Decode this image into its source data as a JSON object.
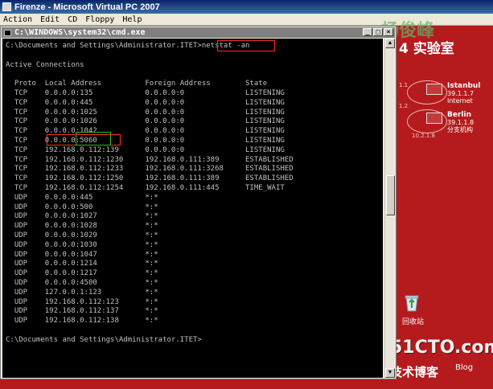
{
  "vpc": {
    "title": "Firenze - Microsoft Virtual PC 2007",
    "menu": [
      "Action",
      "Edit",
      "CD",
      "Floppy",
      "Help"
    ]
  },
  "cmd": {
    "title": "C:\\WINDOWS\\system32\\cmd.exe",
    "buttons": [
      "_",
      "□",
      "×"
    ],
    "lines": [
      "C:\\Documents and Settings\\Administrator.ITET>netstat -an",
      "",
      "Active Connections",
      "",
      "  Proto  Local Address          Foreign Address        State",
      "  TCP    0.0.0.0:135            0.0.0.0:0              LISTENING",
      "  TCP    0.0.0.0:445            0.0.0.0:0              LISTENING",
      "  TCP    0.0.0.0:1025           0.0.0.0:0              LISTENING",
      "  TCP    0.0.0.0:1026           0.0.0.0:0              LISTENING",
      "  TCP    0.0.0.0:1042           0.0.0.0:0              LISTENING",
      "  TCP    0.0.0.0:5060           0.0.0.0:0              LISTENING",
      "  TCP    192.168.0.112:139      0.0.0.0:0              LISTENING",
      "  TCP    192.168.0.112:1230     192.168.0.111:389      ESTABLISHED",
      "  TCP    192.168.0.112:1233     192.168.0.111:3268     ESTABLISHED",
      "  TCP    192.168.0.112:1250     192.168.0.111:389      ESTABLISHED",
      "  TCP    192.168.0.112:1254     192.168.0.111:445      TIME_WAIT",
      "  UDP    0.0.0.0:445            *:*",
      "  UDP    0.0.0.0:500            *:*",
      "  UDP    0.0.0.0:1027           *:*",
      "  UDP    0.0.0.0:1028           *:*",
      "  UDP    0.0.0.0:1029           *:*",
      "  UDP    0.0.0.0:1030           *:*",
      "  UDP    0.0.0.0:1047           *:*",
      "  UDP    0.0.0.0:1214           *:*",
      "  UDP    0.0.0.0:1217           *:*",
      "  UDP    0.0.0.0:4500           *:*",
      "  UDP    127.0.0.1:123          *:*",
      "  UDP    192.168.0.112:123      *:*",
      "  UDP    192.168.0.112:137      *:*",
      "  UDP    192.168.0.112:138      *:*",
      "",
      "C:\\Documents and Settings\\Administrator.ITET>"
    ]
  },
  "desktop": {
    "lab_title": "4 实验室",
    "watermark_top": "杨俊峰",
    "node1": {
      "name": "Istanbul",
      "ip": "39.1.1.7",
      "sub": "Internet"
    },
    "node2": {
      "name": "Berlin",
      "ip": "39.1.1.8",
      "sub": "分支机构"
    },
    "ip_a": "1.1",
    "ip_b": "1.2",
    "ip_c": "10.2.1.8",
    "recycle_label": "回收站",
    "brand": "51CTO.com",
    "brand_sub": "技术博客",
    "brand_blog": "Blog"
  },
  "colors": {
    "desktop_bg": "#b51b1d",
    "console_bg": "#000000",
    "console_fg": "#c0c0c0",
    "highlight": "#ff2a2a"
  }
}
